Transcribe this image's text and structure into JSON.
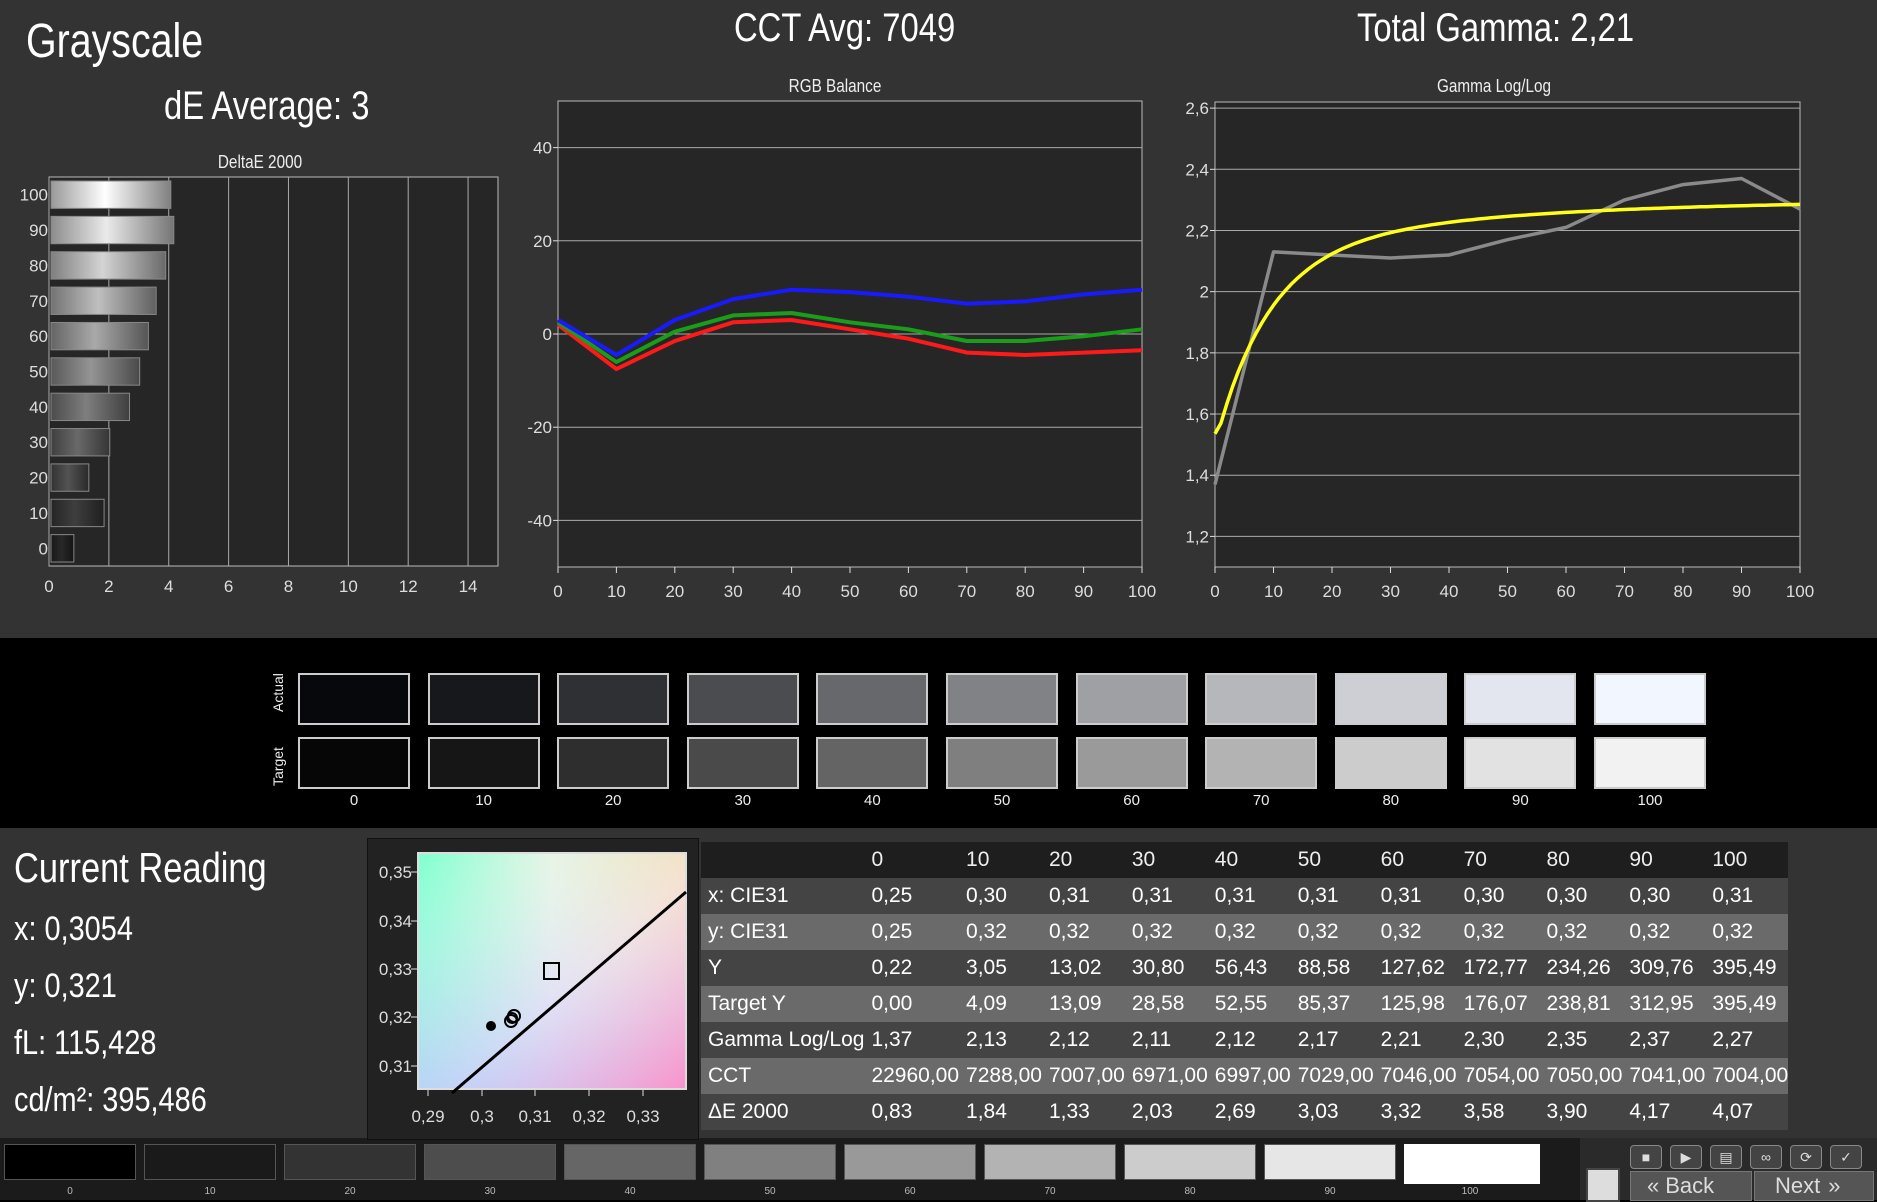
{
  "header": {
    "title": "Grayscale",
    "de_average": "dE Average: 3",
    "cct_avg": "CCT Avg: 7049",
    "total_gamma": "Total Gamma: 2,21"
  },
  "chart_data": [
    {
      "type": "bar",
      "title": "DeltaE 2000",
      "orientation": "horizontal",
      "categories": [
        "100",
        "90",
        "80",
        "70",
        "60",
        "50",
        "40",
        "30",
        "20",
        "10",
        "0"
      ],
      "values": [
        4.07,
        4.17,
        3.9,
        3.58,
        3.32,
        3.03,
        2.69,
        2.03,
        1.33,
        1.84,
        0.83
      ],
      "xlim": [
        0,
        15
      ],
      "xticks": [
        "0",
        "2",
        "4",
        "6",
        "8",
        "10",
        "12",
        "14"
      ]
    },
    {
      "type": "line",
      "title": "RGB Balance",
      "x": [
        0,
        10,
        20,
        30,
        40,
        50,
        60,
        70,
        80,
        90,
        100
      ],
      "ylim": [
        -50,
        50
      ],
      "yticks": [
        "40",
        "20",
        "0",
        "-20",
        "-40"
      ],
      "xticks": [
        "0",
        "10",
        "20",
        "30",
        "40",
        "50",
        "60",
        "70",
        "80",
        "90",
        "100"
      ],
      "series": [
        {
          "color": "#ff1a1a",
          "values": [
            2,
            -7.5,
            -1.5,
            2.5,
            3,
            1,
            -1,
            -4,
            -4.5,
            -4,
            -3.5
          ]
        },
        {
          "color": "#1a9e1a",
          "values": [
            2.5,
            -6,
            0.5,
            4,
            4.5,
            2.5,
            1,
            -1.5,
            -1.5,
            -0.5,
            1
          ]
        },
        {
          "color": "#1a1aff",
          "values": [
            3,
            -4.5,
            3,
            7.5,
            9.5,
            9,
            8,
            6.5,
            7,
            8.5,
            9.5
          ]
        }
      ]
    },
    {
      "type": "line",
      "title": "Gamma Log/Log",
      "x": [
        0,
        10,
        20,
        30,
        40,
        50,
        60,
        70,
        80,
        90,
        100
      ],
      "ylim": [
        1.1,
        2.62
      ],
      "yticks": [
        "2,6",
        "2,4",
        "2,2",
        "2",
        "1,8",
        "1,6",
        "1,4",
        "1,2"
      ],
      "xticks": [
        "0",
        "10",
        "20",
        "30",
        "40",
        "50",
        "60",
        "70",
        "80",
        "90",
        "100"
      ],
      "series": [
        {
          "color": "#8a8a8a",
          "values": [
            1.37,
            2.13,
            2.12,
            2.11,
            2.12,
            2.17,
            2.21,
            2.3,
            2.35,
            2.37,
            2.27
          ]
        },
        {
          "color": "#ffff1a",
          "target_gamma": 2.3
        }
      ]
    }
  ],
  "swatches": {
    "actual_label": "Actual",
    "target_label": "Target",
    "labels": [
      "0",
      "10",
      "20",
      "30",
      "40",
      "50",
      "60",
      "70",
      "80",
      "90",
      "100"
    ],
    "actual_colors": [
      "#07080c",
      "#16181c",
      "#2e3034",
      "#4a4c50",
      "#66686c",
      "#808286",
      "#9ea0a4",
      "#b5b7bb",
      "#cdcfd5",
      "#e3e6ee",
      "#f2f6ff"
    ],
    "target_colors": [
      "#060606",
      "#161616",
      "#2e2e2e",
      "#4a4a4a",
      "#646464",
      "#7f7f7f",
      "#9a9a9a",
      "#b3b3b3",
      "#cccccc",
      "#e2e2e2",
      "#f2f2f2"
    ]
  },
  "current_reading": {
    "title": "Current Reading",
    "x": "x: 0,3054",
    "y": "y: 0,321",
    "fl": "fL: 115,428",
    "cdm2": "cd/m²: 395,486"
  },
  "cie_plot": {
    "xticks": [
      "0,29",
      "0,3",
      "0,31",
      "0,32",
      "0,33"
    ],
    "yticks": [
      "0,35",
      "0,34",
      "0,33",
      "0,32",
      "0,31"
    ]
  },
  "table": {
    "headers": [
      "",
      "0",
      "10",
      "20",
      "30",
      "40",
      "50",
      "60",
      "70",
      "80",
      "90",
      "100"
    ],
    "rows": [
      [
        "x: CIE31",
        "0,25",
        "0,30",
        "0,31",
        "0,31",
        "0,31",
        "0,31",
        "0,31",
        "0,30",
        "0,30",
        "0,30",
        "0,31"
      ],
      [
        "y: CIE31",
        "0,25",
        "0,32",
        "0,32",
        "0,32",
        "0,32",
        "0,32",
        "0,32",
        "0,32",
        "0,32",
        "0,32",
        "0,32"
      ],
      [
        "Y",
        "0,22",
        "3,05",
        "13,02",
        "30,80",
        "56,43",
        "88,58",
        "127,62",
        "172,77",
        "234,26",
        "309,76",
        "395,49"
      ],
      [
        "Target Y",
        "0,00",
        "4,09",
        "13,09",
        "28,58",
        "52,55",
        "85,37",
        "125,98",
        "176,07",
        "238,81",
        "312,95",
        "395,49"
      ],
      [
        "Gamma Log/Log",
        "1,37",
        "2,13",
        "2,12",
        "2,11",
        "2,12",
        "2,17",
        "2,21",
        "2,30",
        "2,35",
        "2,37",
        "2,27"
      ],
      [
        "CCT",
        "22960,00",
        "7288,00",
        "7007,00",
        "6971,00",
        "6997,00",
        "7029,00",
        "7046,00",
        "7054,00",
        "7050,00",
        "7041,00",
        "7004,00"
      ],
      [
        "ΔE 2000",
        "0,83",
        "1,84",
        "1,33",
        "2,03",
        "2,69",
        "3,03",
        "3,32",
        "3,58",
        "3,90",
        "4,17",
        "4,07"
      ]
    ]
  },
  "bottom_strip": {
    "labels": [
      "0",
      "10",
      "20",
      "30",
      "40",
      "50",
      "60",
      "70",
      "80",
      "90",
      "100"
    ],
    "colors": [
      "#000000",
      "#1a1a1a",
      "#333333",
      "#4d4d4d",
      "#666666",
      "#808080",
      "#999999",
      "#b3b3b3",
      "#cccccc",
      "#e6e6e6",
      "#ffffff"
    ],
    "back_label": "Back",
    "next_label": "Next"
  }
}
